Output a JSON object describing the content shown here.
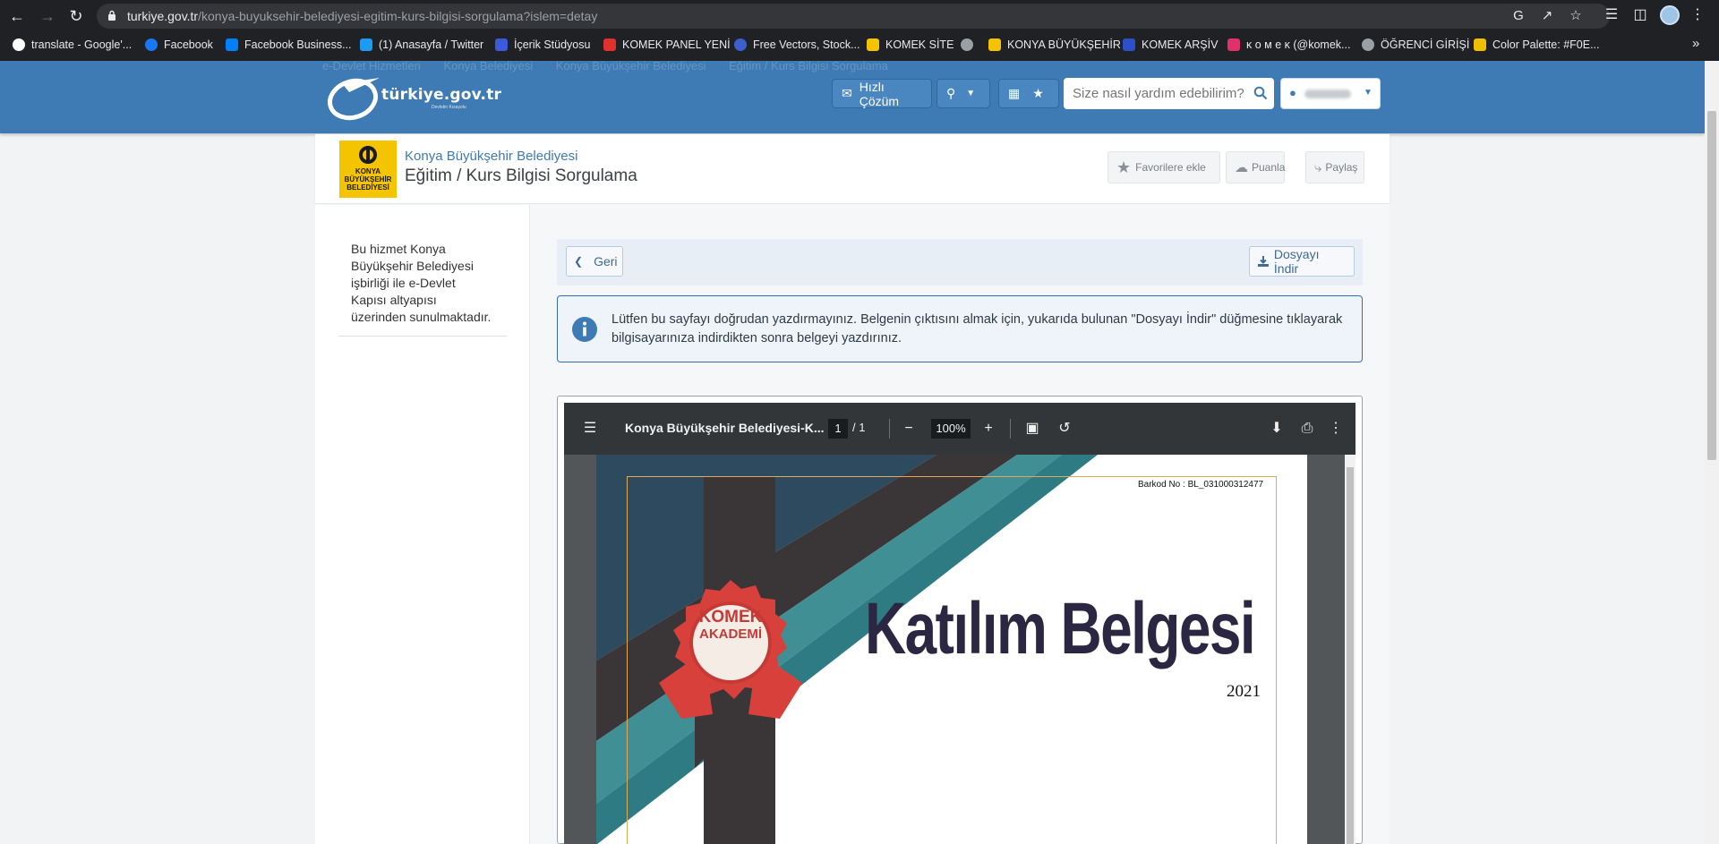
{
  "browser": {
    "url_host": "turkiye.gov.tr",
    "url_path": "/konya-buyuksehir-belediyesi-egitim-kurs-bilgisi-sorgulama?islem=detay",
    "bookmarks": [
      {
        "label": "translate - Google'...",
        "color": "#ffffff"
      },
      {
        "label": "Facebook",
        "color": "#1877f2"
      },
      {
        "label": "Facebook Business...",
        "color": "#0081fb"
      },
      {
        "label": "(1) Anasayfa / Twitter",
        "color": "#1d9bf0"
      },
      {
        "label": "İçerik Stüdyosu",
        "color": "#3b5bdb"
      },
      {
        "label": "KOMEK PANEL YENİ",
        "color": "#e03131"
      },
      {
        "label": "Free Vectors, Stock...",
        "color": "#3c5fcc"
      },
      {
        "label": "KOMEK SİTE",
        "color": "#f5c400"
      },
      {
        "label": "",
        "color": "#9aa0a6"
      },
      {
        "label": "KONYA BÜYÜKŞEHİR",
        "color": "#f5c400"
      },
      {
        "label": "KOMEK ARŞİV",
        "color": "#2b50c8"
      },
      {
        "label": "κ ο м е κ (@komek...",
        "color": "#e1306c"
      },
      {
        "label": "ÖĞRENCİ GİRİŞİ",
        "color": "#9aa0a6"
      },
      {
        "label": "Color Palette: #F0E...",
        "color": "#f0c000"
      }
    ],
    "more": "»"
  },
  "header": {
    "breadcrumb": [
      "e-Devlet Hizmetleri",
      "Konya Belediyesi",
      "Konya Büyükşehir Belediyesi",
      "Eğitim / Kurs Bilgisi Sorgulama"
    ],
    "logo_text": "türkiye.gov.tr",
    "logo_slogan": "Devletin Kısayolu",
    "quick_solution": "Hızlı Çözüm",
    "search_placeholder": "Size nasıl yardım edebilirim?"
  },
  "service": {
    "logo_text": "KONYA BÜYÜKŞEHİR BELEDİYESİ",
    "institution": "Konya Büyükşehir Belediyesi",
    "title": "Eğitim / Kurs Bilgisi Sorgulama",
    "favorite": "Favorilere ekle",
    "rate": "Puanla",
    "share": "Paylaş"
  },
  "sidebar": {
    "note": "Bu hizmet Konya Büyükşehir Belediyesi işbirliği ile e-Devlet Kapısı altyapısı üzerinden sunulmaktadır."
  },
  "main": {
    "back": "Geri",
    "download": "Dosyayı İndir",
    "alert": "Lütfen bu sayfayı doğrudan yazdırmayınız. Belgenin çıktısını almak için, yukarıda bulunan \"Dosyayı İndir\" düğmesine tıklayarak bilgisayarınıza indirdikten sonra belgeyi yazdırınız."
  },
  "pdf": {
    "title": "Konya Büyükşehir Belediyesi-K...",
    "page_current": "1",
    "page_total": "/ 1",
    "zoom": "100%"
  },
  "certificate": {
    "barcode": "Barkod No : BL_031000312477",
    "seal_line1": "KOMEK",
    "seal_line2": "AKADEMİ",
    "title": "Katılım Belgesi",
    "year": "2021"
  },
  "colors": {
    "header_blue": "#3e7ab3",
    "cert_title": "#2b2642",
    "seal_red": "#c63a36",
    "institution_yellow": "#f5c400"
  }
}
